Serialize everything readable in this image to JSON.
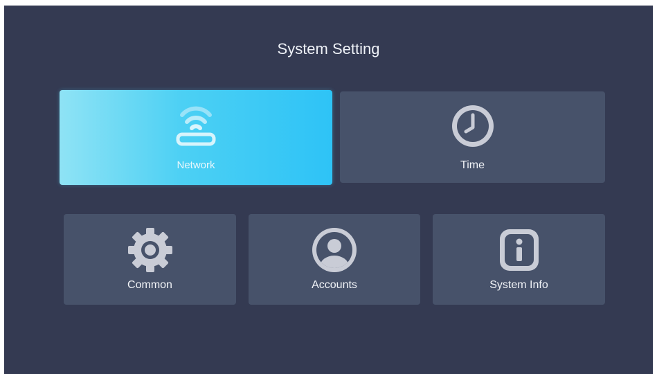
{
  "header": {
    "title": "System Setting"
  },
  "tiles": [
    {
      "id": "network",
      "label": "Network",
      "icon": "wifi-router-icon",
      "selected": true
    },
    {
      "id": "time",
      "label": "Time",
      "icon": "clock-icon",
      "selected": false
    },
    {
      "id": "common",
      "label": "Common",
      "icon": "gear-icon",
      "selected": false
    },
    {
      "id": "accounts",
      "label": "Accounts",
      "icon": "user-icon",
      "selected": false
    },
    {
      "id": "system_info",
      "label": "System Info",
      "icon": "info-icon",
      "selected": false
    }
  ],
  "colors": {
    "background": "#343a52",
    "tile": "#47526a",
    "focus_start": "#8fe3f5",
    "focus_end": "#2ec3f6",
    "icon_fill": "#c9ccd6"
  }
}
